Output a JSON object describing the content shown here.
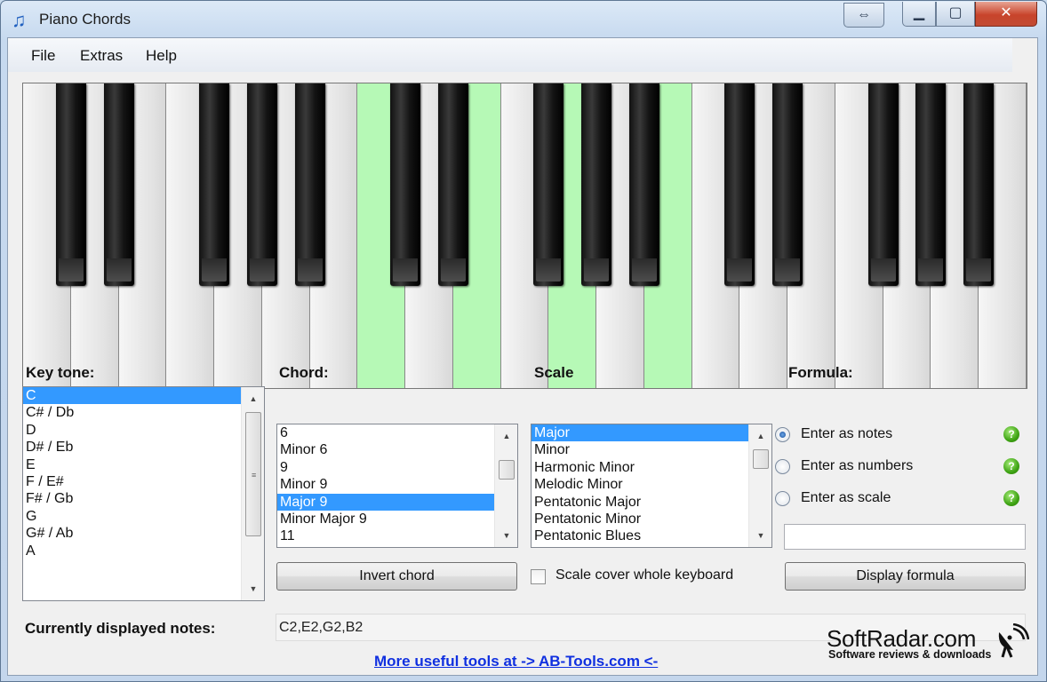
{
  "window": {
    "title": "Piano Chords",
    "controls": {
      "swap": "⇔",
      "minimize": "▁",
      "maximize": "▢",
      "close": "✕"
    }
  },
  "menu": {
    "file": "File",
    "extras": "Extras",
    "help": "Help"
  },
  "keyboard": {
    "white_key_count": 21,
    "highlighted_white_keys": [
      7,
      9,
      11,
      13
    ],
    "highlight_color": "#b6f9b6"
  },
  "key_tone": {
    "label": "Key tone:",
    "items": [
      "C",
      "C# / Db",
      "D",
      "D# / Eb",
      "E",
      "F / E#",
      "F# / Gb",
      "G",
      "G# / Ab",
      "A"
    ],
    "selected": "C"
  },
  "chord": {
    "label": "Chord:",
    "items": [
      "6",
      "Minor 6",
      "9",
      "Minor 9",
      "Major 9",
      "Minor Major 9",
      "11"
    ],
    "selected": "Major 9"
  },
  "scale": {
    "label": "Scale",
    "items": [
      "Major",
      "Minor",
      "Harmonic Minor",
      "Melodic Minor",
      "Pentatonic Major",
      "Pentatonic Minor",
      "Pentatonic Blues"
    ],
    "selected": "Major"
  },
  "formula": {
    "label": "Formula:",
    "options": [
      {
        "label": "Enter as notes",
        "checked": true
      },
      {
        "label": "Enter as numbers",
        "checked": false
      },
      {
        "label": "Enter as scale",
        "checked": false
      }
    ],
    "help_glyph": "?",
    "input_value": "",
    "display_button": "Display formula"
  },
  "invert_button": "Invert chord",
  "scale_cover": {
    "label": "Scale cover whole keyboard",
    "checked": false
  },
  "notes": {
    "label": "Currently displayed notes:",
    "value": "C2,E2,G2,B2"
  },
  "link": "More useful tools at -> AB-Tools.com <-",
  "watermark": {
    "main": "SoftRadar.com",
    "sub": "Software reviews & downloads"
  },
  "colors": {
    "selection": "#3399ff",
    "link": "#1030e0",
    "help_green": "#3ea313"
  }
}
